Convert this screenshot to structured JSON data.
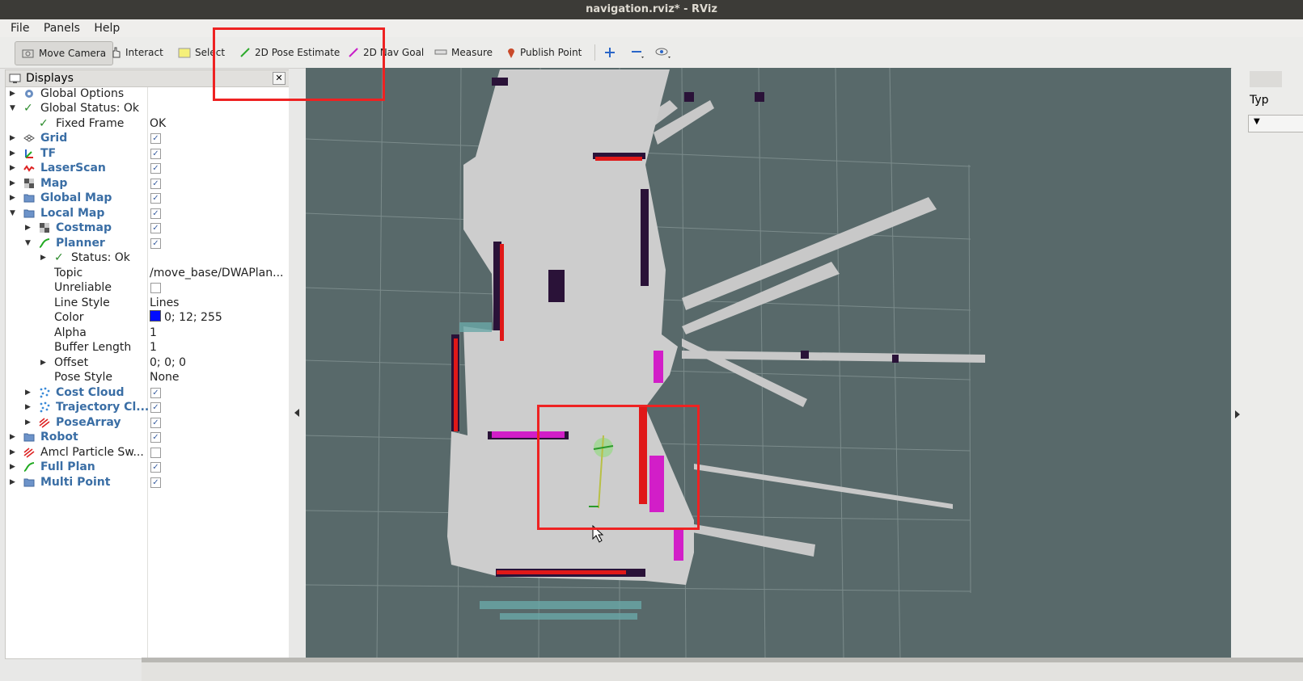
{
  "window": {
    "title": "navigation.rviz* - RViz"
  },
  "menu": [
    "File",
    "Panels",
    "Help"
  ],
  "toolbar": {
    "move_camera": "Move Camera",
    "interact": "Interact",
    "select": "Select",
    "pose_estimate": "2D Pose Estimate",
    "nav_goal": "2D Nav Goal",
    "measure": "Measure",
    "publish_point": "Publish Point"
  },
  "displays": {
    "title": "Displays",
    "rows": [
      {
        "label": "Global Options",
        "value": ""
      },
      {
        "label": "Global Status: Ok",
        "value": ""
      },
      {
        "label": "Fixed Frame",
        "value": "OK"
      },
      {
        "label": "Grid",
        "checked": true
      },
      {
        "label": "TF",
        "checked": true
      },
      {
        "label": "LaserScan",
        "checked": true
      },
      {
        "label": "Map",
        "checked": true
      },
      {
        "label": "Global Map",
        "checked": true
      },
      {
        "label": "Local Map",
        "checked": true
      },
      {
        "label": "Costmap",
        "checked": true
      },
      {
        "label": "Planner",
        "checked": true
      },
      {
        "label": "Status: Ok",
        "value": ""
      },
      {
        "label": "Topic",
        "value": "/move_base/DWAPlan..."
      },
      {
        "label": "Unreliable",
        "checked": false
      },
      {
        "label": "Line Style",
        "value": "Lines"
      },
      {
        "label": "Color",
        "value": "0; 12; 255"
      },
      {
        "label": "Alpha",
        "value": "1"
      },
      {
        "label": "Buffer Length",
        "value": "1"
      },
      {
        "label": "Offset",
        "value": "0; 0; 0"
      },
      {
        "label": "Pose Style",
        "value": "None"
      },
      {
        "label": "Cost Cloud",
        "checked": true
      },
      {
        "label": "Trajectory Cl...",
        "checked": true
      },
      {
        "label": "PoseArray",
        "checked": true
      },
      {
        "label": "Robot",
        "checked": true
      },
      {
        "label": "Amcl Particle Sw...",
        "checked": false
      },
      {
        "label": "Full Plan",
        "checked": true
      },
      {
        "label": "Multi Point",
        "checked": true
      }
    ]
  },
  "right_panel": {
    "label": "Typ"
  },
  "colors": {
    "planner_color": "#000cff",
    "highlight": "#ee2222",
    "grid_bg": "#58696a"
  }
}
